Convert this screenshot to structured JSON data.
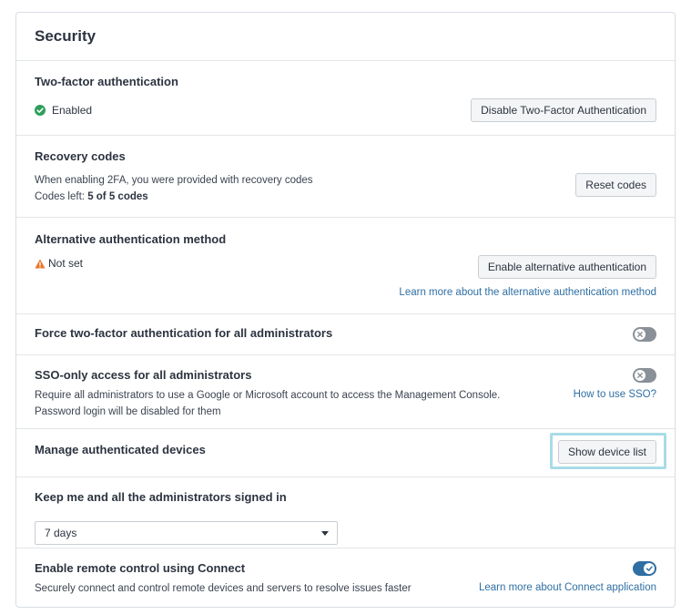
{
  "panel": {
    "title": "Security"
  },
  "two_factor": {
    "title": "Two-factor authentication",
    "status": "Enabled",
    "button": "Disable Two-Factor Authentication"
  },
  "recovery": {
    "title": "Recovery codes",
    "description": "When enabling 2FA, you were provided with recovery codes",
    "codes_prefix": "Codes left:",
    "codes_value": "5 of 5 codes",
    "button": "Reset codes"
  },
  "alt_auth": {
    "title": "Alternative authentication method",
    "status": "Not set",
    "button": "Enable alternative authentication",
    "link": "Learn more about the alternative authentication method"
  },
  "force_2fa": {
    "title": "Force two-factor authentication for all administrators",
    "enabled": false
  },
  "sso": {
    "title": "SSO-only access for all administrators",
    "description_line1": "Require all administrators to use a Google or Microsoft account to access the Management Console.",
    "description_line2": "Password login will be disabled for them",
    "link": "How to use SSO?",
    "enabled": false
  },
  "devices": {
    "title": "Manage authenticated devices",
    "button": "Show device list"
  },
  "signed_in": {
    "title": "Keep me and all the administrators signed in",
    "selected": "7 days"
  },
  "connect": {
    "title": "Enable remote control using Connect",
    "description": "Securely connect and control remote devices and servers to resolve issues faster",
    "link": "Learn more about Connect application",
    "enabled": true
  },
  "colors": {
    "success": "#2e9e5b",
    "warning": "#e8772e",
    "link": "#2f6fa3",
    "toggle_on": "#2f6fa3",
    "toggle_off": "#8a9098",
    "highlight": "#a9dbe8"
  }
}
